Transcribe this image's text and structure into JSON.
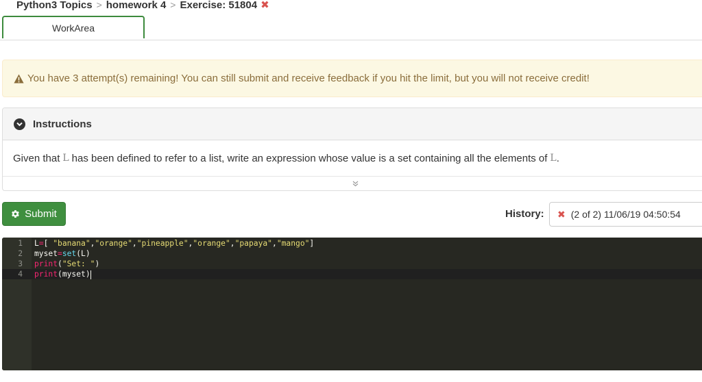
{
  "breadcrumb": {
    "items": [
      "Python3 Topics",
      "homework 4",
      "Exercise: 51804"
    ],
    "separator": ">",
    "close_icon": "close-icon",
    "close_color": "#d9534f"
  },
  "tabs": [
    {
      "label": "WorkArea",
      "active": true
    }
  ],
  "alert": {
    "icon": "warning-icon",
    "text": "You have 3 attempt(s) remaining! You can still submit and receive feedback if you hit the limit, but you will not receive credit!"
  },
  "instructions": {
    "title": "Instructions",
    "icon": "chevron-down-circle-icon",
    "text_before": "Given that",
    "var1": "L",
    "text_middle": "has been defined to refer to a list, write an expression whose value is a set containing all the elements of",
    "var2": "L",
    "text_after": ".",
    "expand_icon": "double-chevron-down-icon"
  },
  "submit": {
    "label": "Submit",
    "icon": "gear-icon",
    "color": "#3f8f3f"
  },
  "history": {
    "label": "History:",
    "icon": "close-icon",
    "selected": "(2 of 2)  11/06/19  04:50:54"
  },
  "editor": {
    "background": "#272822",
    "lines": [
      {
        "number": "1",
        "tokens": [
          {
            "t": "L",
            "c": "plain"
          },
          {
            "t": "=",
            "c": "op"
          },
          {
            "t": "[ ",
            "c": "plain"
          },
          {
            "t": "\"banana\"",
            "c": "str"
          },
          {
            "t": ",",
            "c": "plain"
          },
          {
            "t": "\"orange\"",
            "c": "str"
          },
          {
            "t": ",",
            "c": "plain"
          },
          {
            "t": "\"pineapple\"",
            "c": "str"
          },
          {
            "t": ",",
            "c": "plain"
          },
          {
            "t": "\"orange\"",
            "c": "str"
          },
          {
            "t": ",",
            "c": "plain"
          },
          {
            "t": "\"papaya\"",
            "c": "str"
          },
          {
            "t": ",",
            "c": "plain"
          },
          {
            "t": "\"mango\"",
            "c": "str"
          },
          {
            "t": "]",
            "c": "plain"
          }
        ]
      },
      {
        "number": "2",
        "tokens": [
          {
            "t": "myset",
            "c": "plain"
          },
          {
            "t": "=",
            "c": "op"
          },
          {
            "t": "set",
            "c": "fn"
          },
          {
            "t": "(L)",
            "c": "plain"
          }
        ]
      },
      {
        "number": "3",
        "tokens": [
          {
            "t": "print",
            "c": "op"
          },
          {
            "t": "(",
            "c": "plain"
          },
          {
            "t": "\"Set: \"",
            "c": "str"
          },
          {
            "t": ")",
            "c": "plain"
          }
        ]
      },
      {
        "number": "4",
        "active": true,
        "tokens": [
          {
            "t": "print",
            "c": "op"
          },
          {
            "t": "(myset)",
            "c": "plain"
          }
        ]
      }
    ]
  }
}
